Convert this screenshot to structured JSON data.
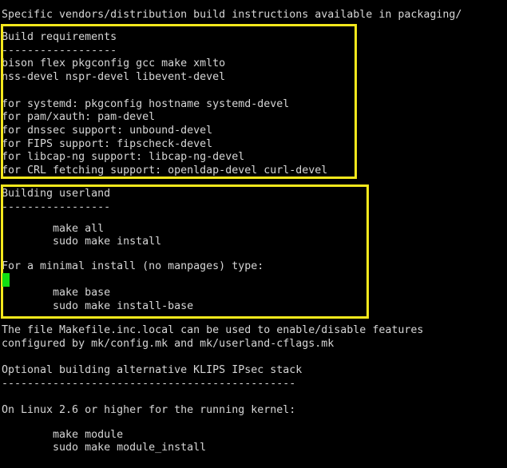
{
  "terminal": {
    "colors": {
      "background": "#000000",
      "foreground": "#d6d6d6",
      "highlight_box": "#f5e81c",
      "cursor": "#12e012"
    },
    "lines": [
      {
        "id": "l01",
        "text": "Specific vendors/distribution build instructions available in packaging/"
      },
      {
        "id": "l02",
        "text": ""
      },
      {
        "id": "l03",
        "text": "Build requirements"
      },
      {
        "id": "l04",
        "text": "------------------"
      },
      {
        "id": "l05",
        "text": "bison flex pkgconfig gcc make xmlto"
      },
      {
        "id": "l06",
        "text": "nss-devel nspr-devel libevent-devel"
      },
      {
        "id": "l07",
        "text": ""
      },
      {
        "id": "l08",
        "text": "for systemd: pkgconfig hostname systemd-devel"
      },
      {
        "id": "l09",
        "text": "for pam/xauth: pam-devel"
      },
      {
        "id": "l10",
        "text": "for dnssec support: unbound-devel"
      },
      {
        "id": "l11",
        "text": "for FIPS support: fipscheck-devel"
      },
      {
        "id": "l12",
        "text": "for libcap-ng support: libcap-ng-devel"
      },
      {
        "id": "l13",
        "text": "for CRL fetching support: openldap-devel curl-devel"
      },
      {
        "id": "l14",
        "text": ""
      },
      {
        "id": "l15",
        "text": "Building userland"
      },
      {
        "id": "l16",
        "text": "-----------------"
      },
      {
        "id": "l17",
        "text": ""
      },
      {
        "id": "l18",
        "text": "        make all"
      },
      {
        "id": "l19",
        "text": "        sudo make install"
      },
      {
        "id": "l20",
        "text": ""
      },
      {
        "id": "l21",
        "text": "For a minimal install (no manpages) type:"
      },
      {
        "id": "l22",
        "text": ""
      },
      {
        "id": "l23",
        "text": "        make base"
      },
      {
        "id": "l24",
        "text": "        sudo make install-base"
      },
      {
        "id": "l25",
        "text": ""
      },
      {
        "id": "l26",
        "text": "The file Makefile.inc.local can be used to enable/disable features"
      },
      {
        "id": "l27",
        "text": "configured by mk/config.mk and mk/userland-cflags.mk"
      },
      {
        "id": "l28",
        "text": ""
      },
      {
        "id": "l29",
        "text": "Optional building alternative KLIPS IPsec stack"
      },
      {
        "id": "l30",
        "text": "----------------------------------------------"
      },
      {
        "id": "l31",
        "text": ""
      },
      {
        "id": "l32",
        "text": "On Linux 2.6 or higher for the running kernel:"
      },
      {
        "id": "l33",
        "text": ""
      },
      {
        "id": "l34",
        "text": "        make module"
      },
      {
        "id": "l35",
        "text": "        sudo make module_install"
      }
    ],
    "highlight_boxes": [
      {
        "id": "box-requirements",
        "label": "Build requirements"
      },
      {
        "id": "box-userland",
        "label": "Building userland"
      }
    ]
  }
}
